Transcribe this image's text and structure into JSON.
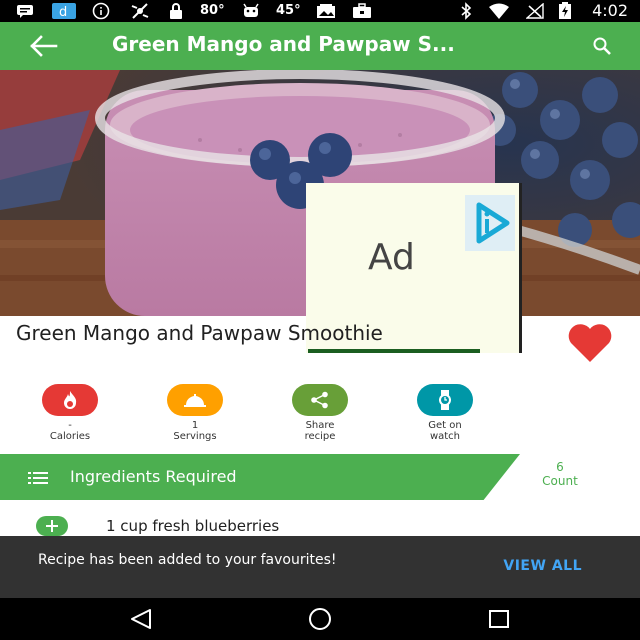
{
  "status_bar": {
    "temp1": "80°",
    "temp2": "45°",
    "time": "4:02",
    "icons": [
      "message-icon",
      "app-d-icon",
      "info-icon",
      "fan-icon",
      "lock-icon",
      "android-icon",
      "photo-icon",
      "briefcase-icon",
      "bluetooth-icon",
      "wifi-icon",
      "no-signal-icon",
      "battery-charging-icon"
    ]
  },
  "app_bar": {
    "title": "Green Mango and Pawpaw S...",
    "back_icon": "arrow-back-icon",
    "search_icon": "search-icon",
    "color": "#4CAF50"
  },
  "ad": {
    "label": "Ad"
  },
  "recipe": {
    "title": "Green Mango and Pawpaw Smoothie",
    "favorite": true,
    "heart_color": "#E53935"
  },
  "actions": [
    {
      "value": "-",
      "label": "Calories",
      "icon": "flame-icon",
      "color": "#E53935"
    },
    {
      "value": "1",
      "label": "Servings",
      "icon": "cloche-icon",
      "color": "#FFA000"
    },
    {
      "value": "",
      "label": "Share recipe",
      "icon": "share-icon",
      "color": "#689F38"
    },
    {
      "value": "",
      "label": "Get on watch",
      "icon": "watch-icon",
      "color": "#0097A7"
    }
  ],
  "ingredients": {
    "title": "Ingredients Required",
    "count_value": "6",
    "count_label": "Count",
    "items": [
      {
        "text": "1 cup fresh blueberries"
      }
    ]
  },
  "snackbar": {
    "message": "Recipe has been added to your favourites!",
    "action": "VIEW ALL",
    "action_color": "#42A5F5"
  }
}
